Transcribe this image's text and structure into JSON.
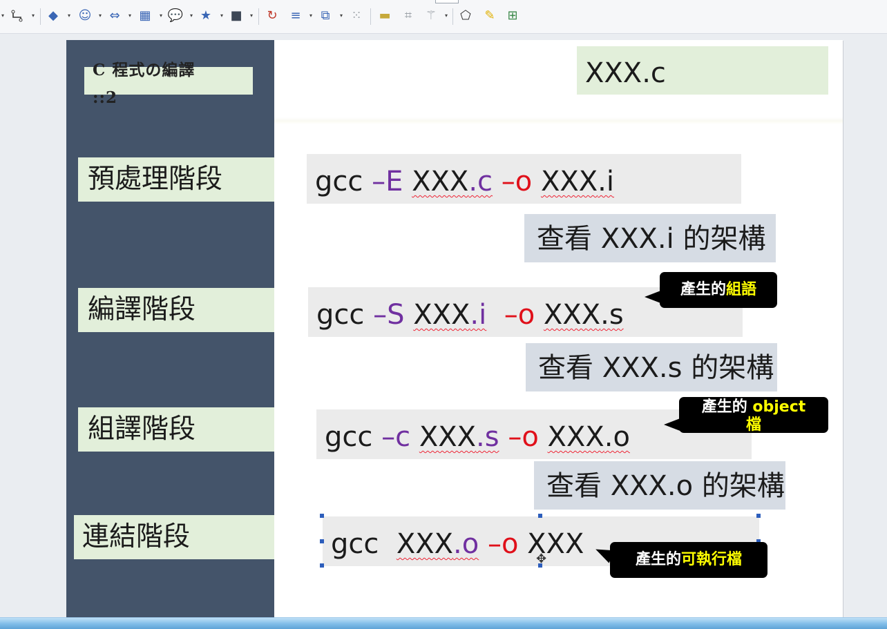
{
  "toolbar": {
    "icons": [
      "connector-icon",
      "diamond-shape-icon",
      "smiley-icon",
      "double-arrow-icon",
      "flowchart-icon",
      "callout-icon",
      "star-icon",
      "3d-object-icon",
      "rotate-icon",
      "align-icon",
      "arrange-icon",
      "distribute-icon",
      "shadow-icon",
      "crop-icon",
      "filter-icon",
      "points-icon",
      "glue-icon",
      "insert-object-icon"
    ]
  },
  "slide": {
    "title": "C 程式の編譯 ::2",
    "file": "XXX.c",
    "stages": [
      "預處理階段",
      "編譯階段",
      "組譯階段",
      "連結階段"
    ],
    "commands": {
      "preprocess": {
        "gcc": "gcc",
        "switch": "–E",
        "input_base": "XXX",
        "input_ext": ".c",
        "out": "–o",
        "output_base": "XXX",
        "output_ext": ".i"
      },
      "compile": {
        "gcc": "gcc",
        "switch": "–S",
        "input_base": "XXX",
        "input_ext": ".i",
        "out": "–o",
        "output_base": "XXX",
        "output_ext": ".s"
      },
      "assemble": {
        "gcc": "gcc",
        "switch": "–c",
        "input_base": "XXX",
        "input_ext": ".s",
        "out": "–o",
        "output_base": "XXX",
        "output_ext": ".o"
      },
      "link": {
        "gcc": "gcc",
        "input_base": "XXX",
        "input_ext": ".o",
        "out": "–o",
        "output": "XXX"
      }
    },
    "views": [
      "查看 XXX.i 的架構",
      "查看 XXX.s 的架構",
      "查看 XXX.o 的架構"
    ],
    "callouts": {
      "compile": {
        "prefix": "產生的",
        "highlight": "組語"
      },
      "assemble": {
        "prefix": "產生的 ",
        "highlight": "object 檔"
      },
      "link": {
        "prefix": "產生的",
        "highlight": "可執行檔"
      }
    }
  },
  "colors": {
    "sidebar": "#44546a",
    "label_bg": "#e2efda",
    "command_bg": "#ebebeb",
    "view_bg": "#d6dce4",
    "switch": "#7030a0",
    "output_flag": "#e0101a",
    "callout_bg": "#000000",
    "callout_highlight": "#ffff00"
  }
}
